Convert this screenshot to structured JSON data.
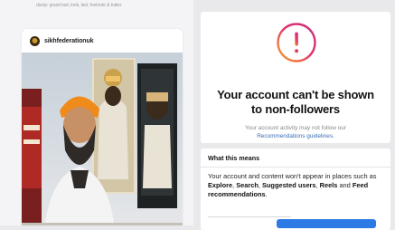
{
  "top_caption": "dump: grand last, look, last, footnote & trailer",
  "post": {
    "handle": "sikhfederationuk",
    "image_description_text": ""
  },
  "restriction": {
    "title_line1": "Your account can't be shown",
    "title_line2": "to non-followers",
    "subtitle_part1": "Your account activity may not follow our",
    "subtitle_link": "Recommendations guidelines."
  },
  "what_this_means": {
    "title": "What this means",
    "body_text1": "Your account and content won't appear in places such as ",
    "explore": "Explore",
    "sep1": ", ",
    "search": "Search",
    "sep2": ", ",
    "suggested_users": "Suggested users",
    "sep3": ", ",
    "reels": "Reels",
    "sep4": " and ",
    "feed_recommendations": "Feed recommendations",
    "end": "."
  },
  "colors": {
    "accent_blue": "#2c7be5",
    "link_blue": "#3a6fb5",
    "alert_gradient_start": "#f9a52b",
    "alert_gradient_end": "#c13584"
  },
  "icons": {
    "alert": "exclamation-circle-icon",
    "avatar": "profile-avatar"
  }
}
